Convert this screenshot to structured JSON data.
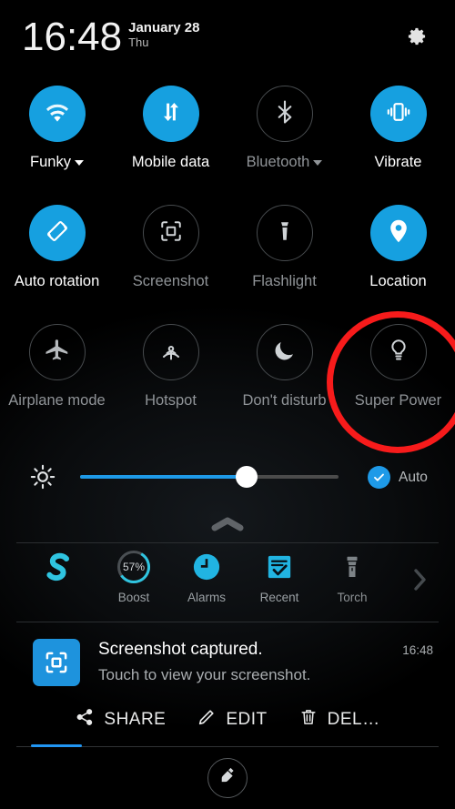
{
  "statusbar": {
    "time": "16:48",
    "date": "January 28",
    "weekday": "Thu",
    "settings_icon": "gear-icon"
  },
  "quick_settings": {
    "rows": [
      [
        {
          "label": "Funky",
          "icon": "wifi-icon",
          "active": true,
          "has_dropdown": true
        },
        {
          "label": "Mobile data",
          "icon": "mobile-data-icon",
          "active": true,
          "has_dropdown": false
        },
        {
          "label": "Bluetooth",
          "icon": "bluetooth-icon",
          "active": false,
          "has_dropdown": true
        },
        {
          "label": "Vibrate",
          "icon": "vibrate-icon",
          "active": true,
          "has_dropdown": false
        }
      ],
      [
        {
          "label": "Auto rotation",
          "icon": "auto-rotate-icon",
          "active": true,
          "has_dropdown": false
        },
        {
          "label": "Screenshot",
          "icon": "screenshot-icon",
          "active": false,
          "has_dropdown": false
        },
        {
          "label": "Flashlight",
          "icon": "flashlight-icon",
          "active": false,
          "has_dropdown": false
        },
        {
          "label": "Location",
          "icon": "location-pin-icon",
          "active": true,
          "has_dropdown": false
        }
      ],
      [
        {
          "label": "Airplane mode",
          "icon": "airplane-icon",
          "active": false,
          "has_dropdown": false
        },
        {
          "label": "Hotspot",
          "icon": "hotspot-icon",
          "active": false,
          "has_dropdown": false
        },
        {
          "label": "Don't disturb",
          "icon": "moon-icon",
          "active": false,
          "has_dropdown": false
        },
        {
          "label": "Super Power",
          "icon": "lightbulb-icon",
          "active": false,
          "has_dropdown": false
        }
      ]
    ]
  },
  "annotation": {
    "shape": "circle",
    "color": "#f71b1b",
    "targets": "Super Power"
  },
  "brightness": {
    "icon": "brightness-icon",
    "value_percent": 64,
    "auto_label": "Auto",
    "auto_checked": true,
    "accent": "#1e9ae8"
  },
  "collapse_handle": {
    "icon": "chevron-up-icon"
  },
  "shortcuts": {
    "items": [
      {
        "label": "",
        "icon": "security-s-logo",
        "color": "#2fc4e0",
        "dim": false
      },
      {
        "label": "Boost",
        "icon": "boost-ring-icon",
        "value": "57%",
        "dim": false
      },
      {
        "label": "Alarms",
        "icon": "clock-icon",
        "color": "#21b4e2",
        "dim": false
      },
      {
        "label": "Recent",
        "icon": "recent-tasks-icon",
        "color": "#21b4e2",
        "dim": false
      },
      {
        "label": "Torch",
        "icon": "torch-icon",
        "color": "#7d8387",
        "dim": true
      }
    ],
    "more_icon": "chevron-right-icon"
  },
  "notification": {
    "icon": "screenshot-capture-icon",
    "title": "Screenshot captured.",
    "body": "Touch to view your screenshot.",
    "time": "16:48",
    "actions": [
      {
        "label": "SHARE",
        "icon": "share-icon"
      },
      {
        "label": "EDIT",
        "icon": "pencil-icon"
      },
      {
        "label": "DEL…",
        "icon": "trash-icon"
      }
    ]
  },
  "footer": {
    "clear_all_icon": "broom-icon",
    "scroll_indicator_color": "#2196f3"
  }
}
